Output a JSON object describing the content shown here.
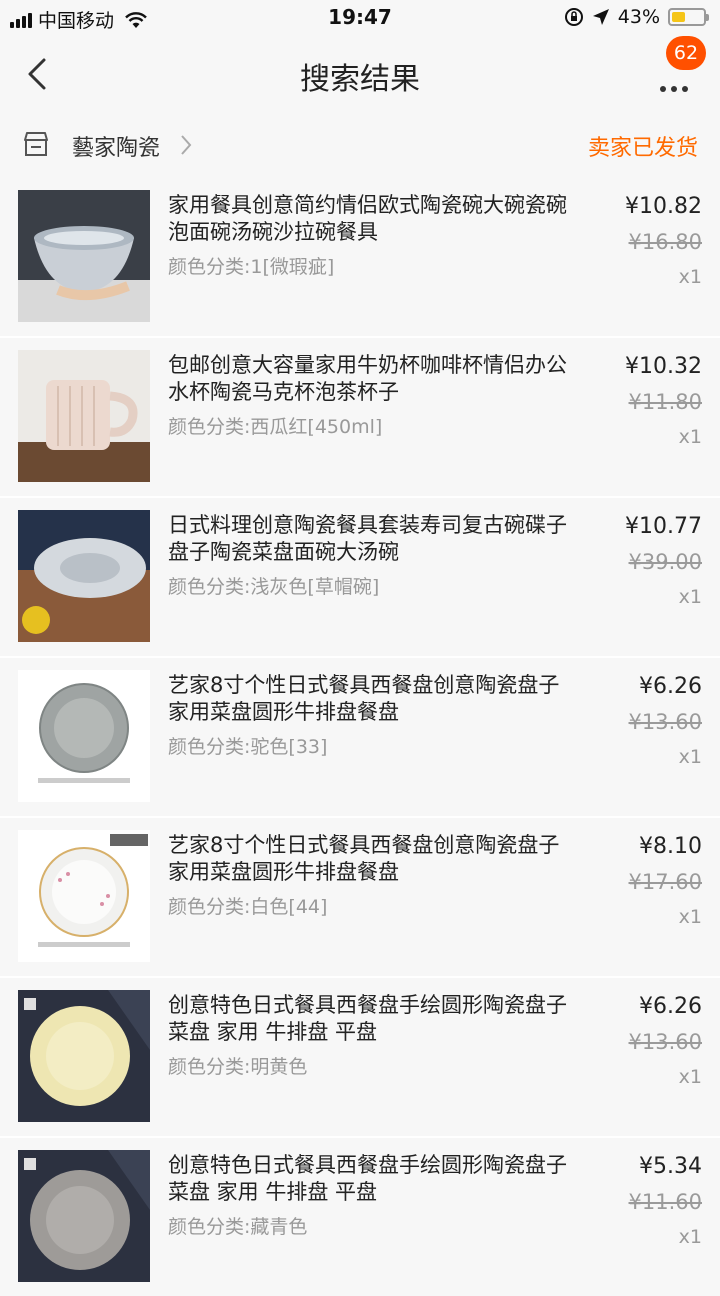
{
  "status_bar": {
    "carrier": "中国移动",
    "time": "19:47",
    "battery": "43%",
    "battery_level": 0.43
  },
  "nav": {
    "title": "搜索结果",
    "badge": "62"
  },
  "shop": {
    "name": "藝家陶瓷",
    "status": "卖家已发货"
  },
  "items": [
    {
      "title": "家用餐具创意简约情侣欧式陶瓷碗大碗瓷碗泡面碗汤碗沙拉碗餐具",
      "spec": "颜色分类:1[微瑕疵]",
      "price": "¥10.82",
      "original_price": "¥16.80",
      "quantity": "x1"
    },
    {
      "title": "包邮创意大容量家用牛奶杯咖啡杯情侣办公水杯陶瓷马克杯泡茶杯子",
      "spec": "颜色分类:西瓜红[450ml]",
      "price": "¥10.32",
      "original_price": "¥11.80",
      "quantity": "x1"
    },
    {
      "title": "日式料理创意陶瓷餐具套装寿司复古碗碟子盘子陶瓷菜盘面碗大汤碗",
      "spec": "颜色分类:浅灰色[草帽碗]",
      "price": "¥10.77",
      "original_price": "¥39.00",
      "quantity": "x1"
    },
    {
      "title": "艺家8寸个性日式餐具西餐盘创意陶瓷盘子家用菜盘圆形牛排盘餐盘",
      "spec": "颜色分类:驼色[33]",
      "price": "¥6.26",
      "original_price": "¥13.60",
      "quantity": "x1"
    },
    {
      "title": "艺家8寸个性日式餐具西餐盘创意陶瓷盘子家用菜盘圆形牛排盘餐盘",
      "spec": "颜色分类:白色[44]",
      "price": "¥8.10",
      "original_price": "¥17.60",
      "quantity": "x1"
    },
    {
      "title": "创意特色日式餐具西餐盘手绘圆形陶瓷盘子 菜盘 家用 牛排盘 平盘",
      "spec": "颜色分类:明黄色",
      "price": "¥6.26",
      "original_price": "¥13.60",
      "quantity": "x1"
    },
    {
      "title": "创意特色日式餐具西餐盘手绘圆形陶瓷盘子 菜盘 家用 牛排盘 平盘",
      "spec": "颜色分类:藏青色",
      "price": "¥5.34",
      "original_price": "¥11.60",
      "quantity": "x1"
    }
  ]
}
